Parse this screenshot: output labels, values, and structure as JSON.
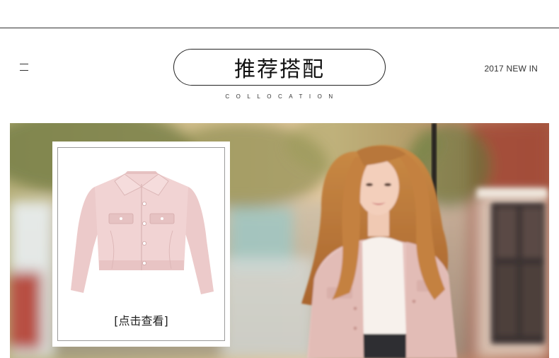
{
  "header": {
    "title": "推荐搭配",
    "subtitle": "COLLOCATION",
    "tag": "2017 NEW IN"
  },
  "product_card": {
    "link_label": "[点击查看]",
    "jacket_color": "#f1d3d3"
  },
  "icons": {
    "menu": "hamburger-icon"
  },
  "colors": {
    "text": "#222222",
    "border": "#333333",
    "coat_pink": "#e8c2bd"
  }
}
